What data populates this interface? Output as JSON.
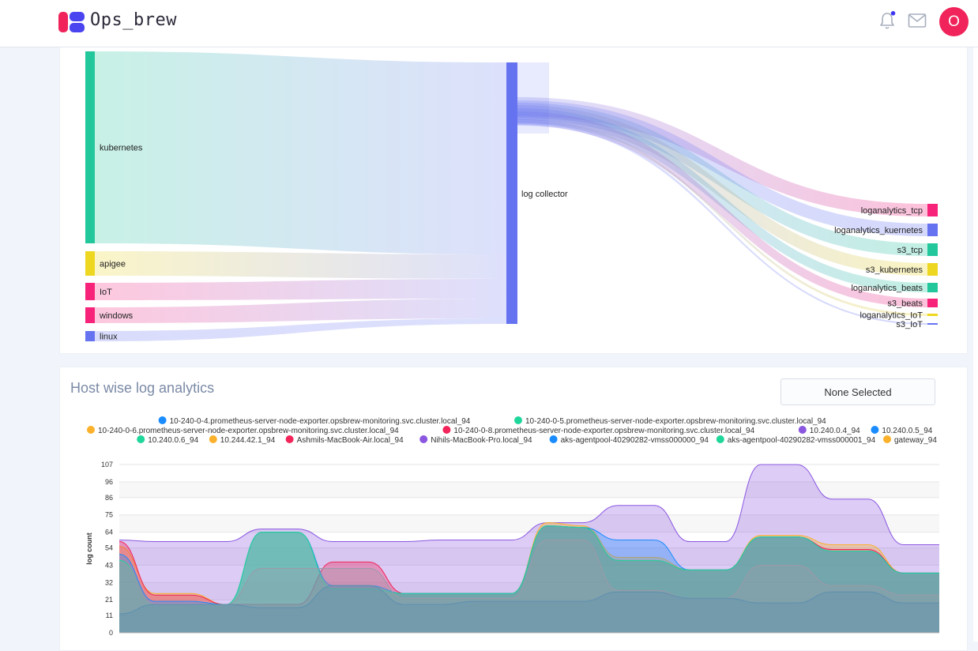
{
  "app": {
    "name": "Ops_brew",
    "avatar_initial": "O"
  },
  "colors": {
    "accent": "#f0245a",
    "primary": "#6673f0"
  },
  "sankey": {
    "sources": [
      {
        "label": "kubernetes",
        "color": "#22c79b"
      },
      {
        "label": "apigee",
        "color": "#eed721"
      },
      {
        "label": "IoT",
        "color": "#f7227a"
      },
      {
        "label": "windows",
        "color": "#f7227a"
      },
      {
        "label": "linux",
        "color": "#6673f0"
      }
    ],
    "hub": {
      "label": "log collector",
      "color": "#6673f0"
    },
    "targets": [
      {
        "label": "loganalytics_tcp",
        "color": "#f7227a"
      },
      {
        "label": "loganalytics_kuernetes",
        "color": "#6673f0"
      },
      {
        "label": "s3_tcp",
        "color": "#22c79b"
      },
      {
        "label": "s3_kubernetes",
        "color": "#eed721"
      },
      {
        "label": "loganalytics_beats",
        "color": "#22c79b"
      },
      {
        "label": "s3_beats",
        "color": "#f7227a"
      },
      {
        "label": "loganalytics_IoT",
        "color": "#eed721"
      },
      {
        "label": "s3_IoT",
        "color": "#6673f0"
      }
    ]
  },
  "analytics": {
    "title": "Host wise log analytics",
    "filter": "None Selected"
  },
  "chart_data": {
    "type": "area",
    "ylabel": "log count",
    "yticks": [
      0,
      11,
      21,
      32,
      43,
      54,
      64,
      75,
      86,
      96,
      107
    ],
    "ylim": [
      0,
      107
    ],
    "grid": true,
    "legend_position": "top",
    "legend": [
      {
        "name": "10-240-0-4.prometheus-server-node-exporter.opsbrew-monitoring.svc.cluster.local_94",
        "color": "#1a8cff"
      },
      {
        "name": "10-240-0-5.prometheus-server-node-exporter.opsbrew-monitoring.svc.cluster.local_94",
        "color": "#1fd69b"
      },
      {
        "name": "10-240-0-6.prometheus-server-node-exporter.opsbrew-monitoring.svc.cluster.local_94",
        "color": "#fbb12b"
      },
      {
        "name": "10-240-0-8.prometheus-server-node-exporter.opsbrew-monitoring.svc.cluster.local_94",
        "color": "#f2245a"
      },
      {
        "name": "10.240.0.4_94",
        "color": "#8b57e0"
      },
      {
        "name": "10.240.0.5_94",
        "color": "#1a8cff"
      },
      {
        "name": "10.240.0.6_94",
        "color": "#1fd69b"
      },
      {
        "name": "10.244.42.1_94",
        "color": "#fbb12b"
      },
      {
        "name": "Ashmils-MacBook-Air.local_94",
        "color": "#f2245a"
      },
      {
        "name": "Nihils-MacBook-Pro.local_94",
        "color": "#8b57e0"
      },
      {
        "name": "aks-agentpool-40290282-vmss000000_94",
        "color": "#1a8cff"
      },
      {
        "name": "aks-agentpool-40290282-vmss000001_94",
        "color": "#1fd69b"
      },
      {
        "name": "gateway_94",
        "color": "#fbb12b"
      }
    ],
    "series": [
      {
        "color": "#8b57e0",
        "values": [
          59,
          58,
          58,
          58,
          66,
          66,
          58,
          58,
          58,
          59,
          59,
          59,
          70,
          70,
          81,
          81,
          58,
          58,
          107,
          107,
          85,
          85,
          56,
          56
        ]
      },
      {
        "color": "#fbb12b",
        "values": [
          55,
          25,
          25,
          18,
          64,
          64,
          30,
          30,
          25,
          25,
          25,
          25,
          70,
          68,
          48,
          48,
          40,
          40,
          62,
          62,
          56,
          56,
          38,
          38
        ]
      },
      {
        "color": "#f2245a",
        "values": [
          58,
          24,
          24,
          18,
          18,
          18,
          45,
          45,
          25,
          25,
          25,
          25,
          68,
          67,
          46,
          46,
          40,
          40,
          61,
          61,
          53,
          53,
          38,
          38
        ]
      },
      {
        "color": "#1a8cff",
        "values": [
          50,
          20,
          20,
          18,
          64,
          64,
          30,
          30,
          25,
          25,
          25,
          25,
          68,
          67,
          59,
          59,
          40,
          40,
          61,
          61,
          52,
          52,
          38,
          38
        ]
      },
      {
        "color": "#1fd69b",
        "values": [
          46,
          18,
          18,
          18,
          64,
          64,
          28,
          28,
          25,
          25,
          25,
          25,
          68,
          67,
          46,
          46,
          40,
          40,
          61,
          61,
          52,
          52,
          38,
          38
        ]
      },
      {
        "color": "#9b9aa8",
        "values": [
          45,
          18,
          18,
          18,
          41,
          41,
          41,
          41,
          22,
          22,
          22,
          22,
          59,
          59,
          27,
          27,
          22,
          22,
          43,
          43,
          30,
          30,
          24,
          24
        ]
      },
      {
        "color": "#5d8fb0",
        "values": [
          12,
          18,
          18,
          18,
          16,
          16,
          30,
          30,
          18,
          18,
          20,
          20,
          20,
          20,
          26,
          26,
          22,
          22,
          19,
          19,
          26,
          26,
          19,
          19
        ]
      }
    ]
  }
}
